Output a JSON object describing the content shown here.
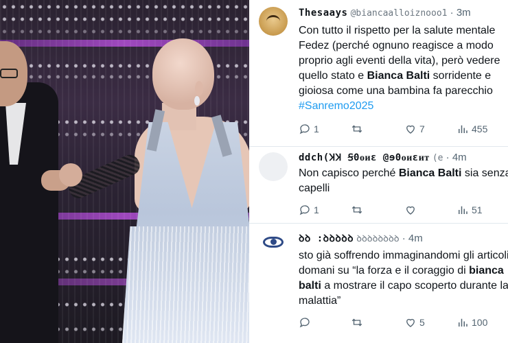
{
  "tweets": [
    {
      "author": "Thesaays",
      "handle": "@biancaalloiznooo1",
      "separator": "·",
      "time": "3m",
      "lines": [
        [
          {
            "t": "Con tutto il rispetto per la salute mentale"
          }
        ],
        [
          {
            "t": "Fedez (perché ognuno reagisce a modo"
          }
        ],
        [
          {
            "t": "proprio agli eventi della vita), però vedere"
          }
        ],
        [
          {
            "t": "quello stato e "
          },
          {
            "t": "Bianca Balti",
            "b": true
          },
          {
            "t": " sorridente e"
          }
        ],
        [
          {
            "t": "gioiosa come una bambina fa parecchio"
          }
        ],
        [
          {
            "t": "#Sanremo2025",
            "tag": true
          }
        ]
      ],
      "stats": {
        "replies": "1",
        "retweets": "",
        "likes": "7",
        "views": "455"
      }
    },
    {
      "author": "ddch(ꞰꞰ Ꞩ0ᴏᴎɛ @ɘ0ᴏᴎɛᴎᴛ",
      "handle": "(e",
      "separator": "·",
      "time": "4m",
      "lines": [
        [
          {
            "t": "Non capisco perché "
          },
          {
            "t": "Bianca Balti",
            "b": true
          },
          {
            "t": " sia senza"
          }
        ],
        [
          {
            "t": "capelli"
          }
        ]
      ],
      "stats": {
        "replies": "1",
        "retweets": "",
        "likes": "",
        "views": "51"
      }
    },
    {
      "author": "ꝺꝺ ꞉ꝺꝺꝺꝺꝺ",
      "handle": "ꝺꝺꝺꝺꝺꝺꝺꝺ",
      "separator": "·",
      "time": "4m",
      "lines": [
        [
          {
            "t": "sto già soffrendo immaginandomi gli articoli"
          }
        ],
        [
          {
            "t": "domani su “la forza e il  coraggio di "
          },
          {
            "t": "bianca",
            "b": true
          }
        ],
        [
          {
            "t": "balti",
            "b": true
          },
          {
            "t": " a mostrare il capo scoperto durante la"
          }
        ],
        [
          {
            "t": "malattia”"
          }
        ]
      ],
      "stats": {
        "replies": "",
        "retweets": "",
        "likes": "5",
        "views": "100"
      }
    }
  ],
  "icons": {
    "reply": "reply-icon",
    "retweet": "retweet-icon",
    "like": "heart-icon",
    "views": "views-icon"
  },
  "colors": {
    "text": "#0f1419",
    "muted": "#536471",
    "hashtag": "#1d9bf0",
    "divider": "#e1e8ed"
  }
}
